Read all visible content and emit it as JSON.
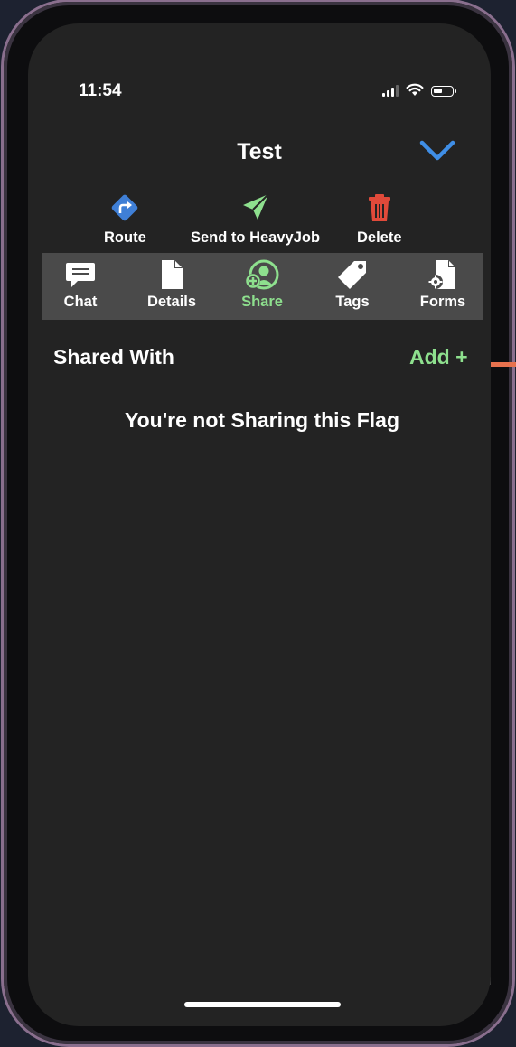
{
  "status_bar": {
    "time": "11:54",
    "signal_icon": "cellular-signal-icon",
    "wifi_icon": "wifi-icon",
    "battery_icon": "battery-icon"
  },
  "header": {
    "title": "Test",
    "collapse_icon": "chevron-down-icon"
  },
  "actions": [
    {
      "label": "Route",
      "icon": "route-icon",
      "color": "#3f7fd6"
    },
    {
      "label": "Send to HeavyJob",
      "icon": "send-icon",
      "color": "#8ee08e"
    },
    {
      "label": "Delete",
      "icon": "trash-icon",
      "color": "#e04a3a"
    }
  ],
  "tabs": [
    {
      "label": "Chat",
      "icon": "chat-icon",
      "active": false
    },
    {
      "label": "Details",
      "icon": "document-icon",
      "active": false
    },
    {
      "label": "Share",
      "icon": "share-user-icon",
      "active": true
    },
    {
      "label": "Tags",
      "icon": "tag-icon",
      "active": false
    },
    {
      "label": "Forms",
      "icon": "forms-icon",
      "active": false
    }
  ],
  "share_section": {
    "heading": "Shared With",
    "add_label": "Add +",
    "empty_message": "You're not Sharing this Flag"
  },
  "colors": {
    "background": "#232323",
    "tabbar": "#4a4a4a",
    "accent_green": "#8ee08e",
    "accent_blue": "#3f7fd6",
    "danger_red": "#e04a3a"
  }
}
